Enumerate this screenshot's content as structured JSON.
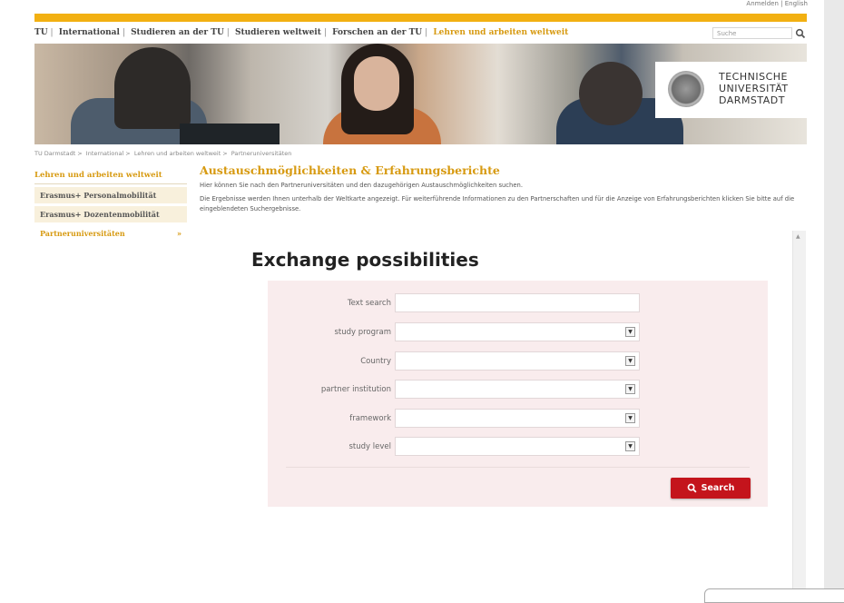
{
  "header": {
    "top_meta": "Anmelden | English",
    "nav": [
      {
        "label": "TU"
      },
      {
        "label": "International"
      },
      {
        "label": "Studieren an der TU"
      },
      {
        "label": "Studieren weltweit"
      },
      {
        "label": "Forschen an der TU"
      },
      {
        "label": "Lehren und arbeiten weltweit",
        "active": true
      }
    ],
    "search_placeholder": "Suche",
    "logo_lines": [
      "TECHNISCHE",
      "UNIVERSITÄT",
      "DARMSTADT"
    ]
  },
  "breadcrumb": [
    "TU Darmstadt",
    "International",
    "Lehren und arbeiten weltweit",
    "Partneruniversitäten"
  ],
  "sidebar": {
    "heading": "Lehren und arbeiten weltweit",
    "items": [
      {
        "label": "Erasmus+ Personalmobilität"
      },
      {
        "label": "Erasmus+ Dozentenmobilität"
      },
      {
        "label": "Partneruniversitäten",
        "active": true,
        "marker": "»"
      }
    ]
  },
  "main": {
    "title": "Austauschmöglichkeiten & Erfahrungsberichte",
    "intro": "Hier können Sie nach den Partneruniversitäten und den dazugehörigen Austauschmöglichkeiten suchen.",
    "info": "Die Ergebnisse werden Ihnen unterhalb der Weltkarte angezeigt. Für weiterführende Informationen zu den Partnerschaften und für die Anzeige von Erfahrungsberichten klicken Sie bitte auf die eingeblendeten Suchergebnisse."
  },
  "exchange": {
    "title": "Exchange possibilities",
    "fields": {
      "text_search": {
        "label": "Text search",
        "value": ""
      },
      "study_program": {
        "label": "study program",
        "value": ""
      },
      "country": {
        "label": "Country",
        "value": ""
      },
      "partner_institution": {
        "label": "partner institution",
        "value": ""
      },
      "framework": {
        "label": "framework",
        "value": ""
      },
      "study_level": {
        "label": "study level",
        "value": ""
      }
    },
    "search_button": "Search"
  },
  "colors": {
    "accent_orange": "#f2b012",
    "accent_text": "#d79a11",
    "form_bg": "#f9eced",
    "button_red": "#c4141c"
  },
  "icons": {
    "search": "magnifier-icon",
    "dropdown": "chevron-down-icon"
  }
}
